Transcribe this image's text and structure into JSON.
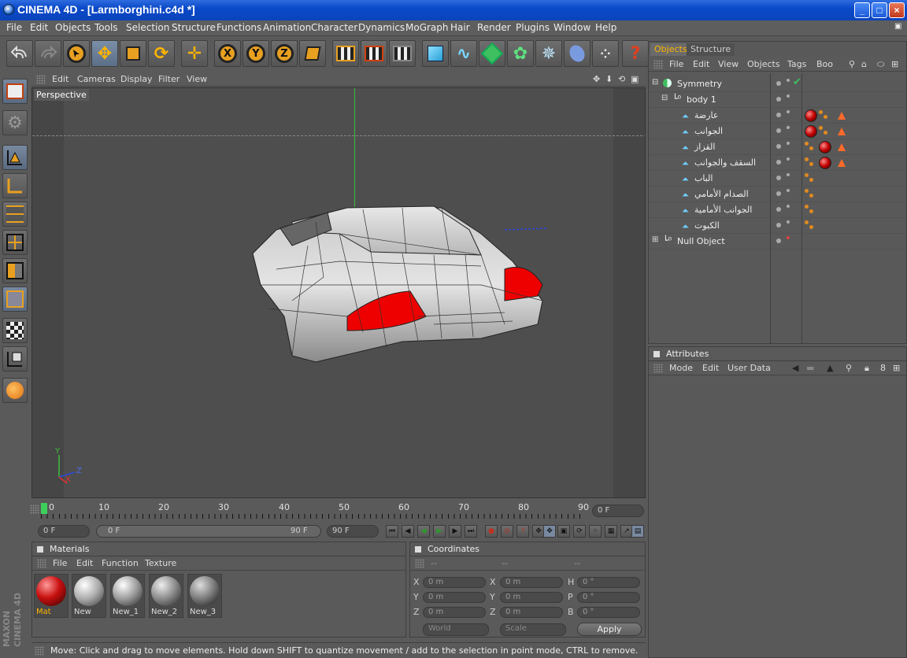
{
  "window": {
    "title": "CINEMA 4D - [Larmborghini.c4d *]",
    "minimize": "_",
    "maximize": "□",
    "close": "×"
  },
  "menu": [
    "File",
    "Edit",
    "Objects",
    "Tools",
    "Selection",
    "Structure",
    "Functions",
    "Animation",
    "Character",
    "Dynamics",
    "MoGraph",
    "Hair",
    "Render",
    "Plugins",
    "Window",
    "Help"
  ],
  "toolbar": {
    "x_label": "X",
    "y_label": "Y",
    "z_label": "Z",
    "help": "?"
  },
  "viewport": {
    "menu": [
      "Edit",
      "Cameras",
      "Display",
      "Filter",
      "View"
    ],
    "label": "Perspective",
    "axes": {
      "x": "X",
      "y": "Y",
      "z": "Z"
    }
  },
  "timeline": {
    "ticks": [
      "0",
      "10",
      "20",
      "30",
      "40",
      "50",
      "60",
      "70",
      "80",
      "90"
    ],
    "current_frame": "0 F",
    "start_field": "0 F",
    "range_start": "0 F",
    "range_end": "90 F",
    "end_field": "90 F"
  },
  "materials": {
    "title": "Materials",
    "menu": [
      "File",
      "Edit",
      "Function",
      "Texture"
    ],
    "items": [
      {
        "name": "Mat",
        "color": "#c81010",
        "selected": true
      },
      {
        "name": "New",
        "color": "#b0b0b0",
        "selected": false
      },
      {
        "name": "New_1",
        "color": "#a8a8a8",
        "selected": false
      },
      {
        "name": "New_2",
        "color": "#9a9a9a",
        "selected": false
      },
      {
        "name": "New_3",
        "color": "#8c8c8c",
        "selected": false
      }
    ]
  },
  "coordinates": {
    "title": "Coordinates",
    "headers": [
      "--",
      "--",
      "--"
    ],
    "rows": [
      {
        "a": "X",
        "av": "0 m",
        "b": "X",
        "bv": "0 m",
        "c": "H",
        "cv": "0 °"
      },
      {
        "a": "Y",
        "av": "0 m",
        "b": "Y",
        "bv": "0 m",
        "c": "P",
        "cv": "0 °"
      },
      {
        "a": "Z",
        "av": "0 m",
        "b": "Z",
        "bv": "0 m",
        "c": "B",
        "cv": "0 °"
      }
    ],
    "mode1": "World",
    "mode2": "Scale",
    "apply": "Apply"
  },
  "status": "Move: Click and drag to move elements. Hold down SHIFT to quantize movement / add to the selection in point mode, CTRL to remove.",
  "objects_panel": {
    "tabs": [
      "Objects",
      "Structure"
    ],
    "menu": [
      "File",
      "Edit",
      "View",
      "Objects",
      "Tags",
      "Boo"
    ],
    "rows": [
      {
        "name": "Symmetry",
        "indent": 0
      },
      {
        "name": "body 1",
        "indent": 1
      },
      {
        "name": "عارضة",
        "indent": 2
      },
      {
        "name": "الجوانب",
        "indent": 2
      },
      {
        "name": "القزاز",
        "indent": 2
      },
      {
        "name": "السقف والجوانب",
        "indent": 2
      },
      {
        "name": "الباب",
        "indent": 2
      },
      {
        "name": "الصدام الأمامي",
        "indent": 2
      },
      {
        "name": "الجوانب الأمامية",
        "indent": 2
      },
      {
        "name": "الكبوت",
        "indent": 2
      },
      {
        "name": "Null Object",
        "indent": 0
      }
    ]
  },
  "attributes_panel": {
    "title": "Attributes",
    "menu": [
      "Mode",
      "Edit",
      "User Data"
    ]
  },
  "brand": "MAXON CINEMA 4D",
  "colors": {
    "accent": "#ffb400",
    "selection_blue": "#0a49c8",
    "material_red": "#c81010"
  }
}
